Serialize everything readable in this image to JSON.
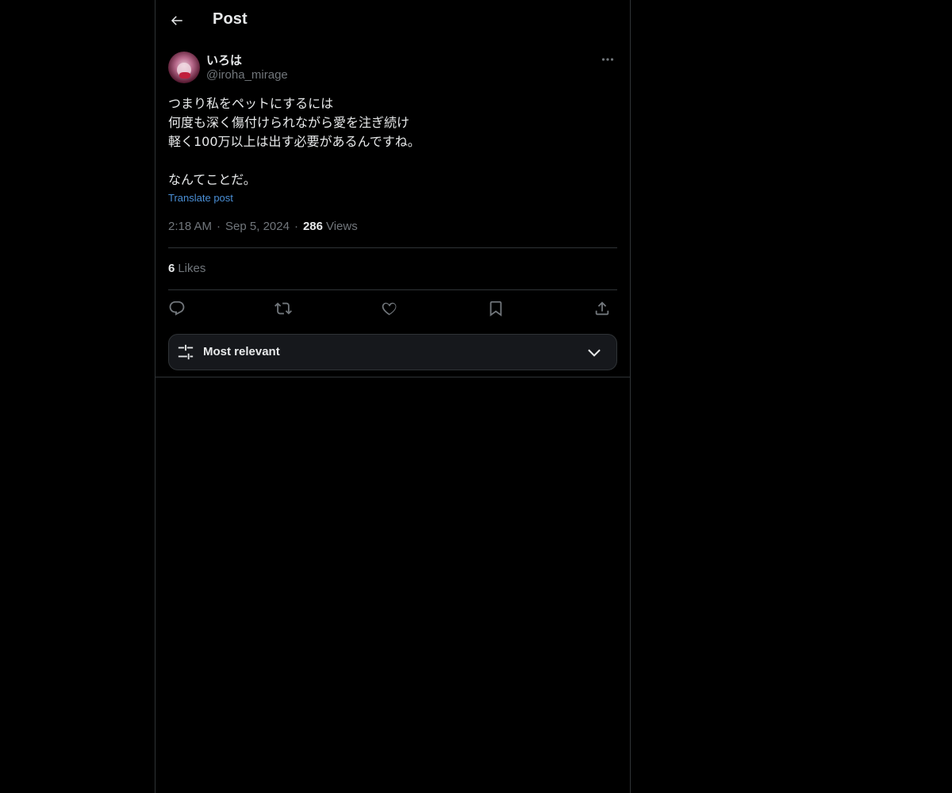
{
  "header": {
    "title": "Post",
    "back_icon": "arrow-left-icon"
  },
  "post": {
    "author": {
      "display_name": "いろは",
      "handle": "@iroha_mirage"
    },
    "body": "つまり私をペットにするには\n何度も深く傷付けられながら愛を注ぎ続け\n軽く100万以上は出す必要があるんですね。\n\nなんてことだ。",
    "translate_label": "Translate post",
    "time": "2:18 AM",
    "date": "Sep 5, 2024",
    "separator": "·",
    "views_count": "286",
    "views_label": "Views",
    "likes_count": "6",
    "likes_label": "Likes"
  },
  "actions": [
    {
      "name": "reply",
      "icon": "reply-icon"
    },
    {
      "name": "repost",
      "icon": "repost-icon"
    },
    {
      "name": "like",
      "icon": "heart-icon"
    },
    {
      "name": "bookmark",
      "icon": "bookmark-icon"
    },
    {
      "name": "share",
      "icon": "share-icon"
    }
  ],
  "replies_sort": {
    "label": "Most relevant",
    "icon": "sliders-icon",
    "chevron": "chevron-down-icon"
  },
  "colors": {
    "background": "#000000",
    "text_primary": "#e7e9ea",
    "text_secondary": "#71767b",
    "link": "#4a8fd6",
    "border": "#2f3336"
  }
}
